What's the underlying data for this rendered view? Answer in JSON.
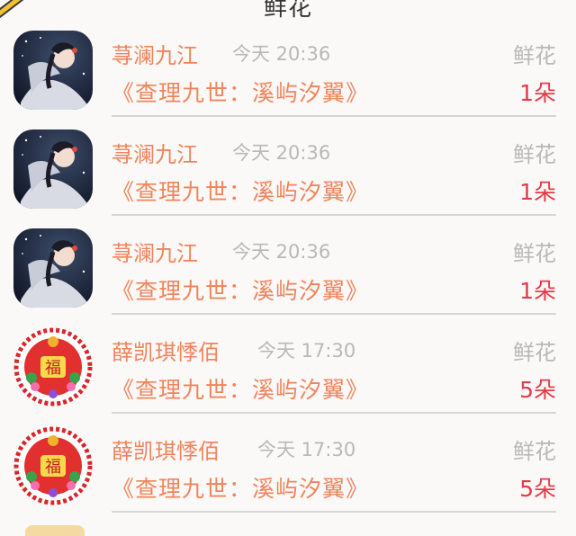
{
  "header": {
    "title": "鲜花"
  },
  "rows": [
    {
      "name": "荨澜九江",
      "time": "今天 20:36",
      "book": "《查理九世：溪屿汐翼》",
      "gift": "鲜花",
      "count": "1朵",
      "avatar": "anime-girl-avatar"
    },
    {
      "name": "荨澜九江",
      "time": "今天 20:36",
      "book": "《查理九世：溪屿汐翼》",
      "gift": "鲜花",
      "count": "1朵",
      "avatar": "anime-girl-avatar"
    },
    {
      "name": "荨澜九江",
      "time": "今天 20:36",
      "book": "《查理九世：溪屿汐翼》",
      "gift": "鲜花",
      "count": "1朵",
      "avatar": "anime-girl-avatar"
    },
    {
      "name": "薛凯琪悸佰",
      "time": "今天 17:30",
      "book": "《查理九世：溪屿汐翼》",
      "gift": "鲜花",
      "count": "5朵",
      "avatar": "fu-papercut-avatar"
    },
    {
      "name": "薛凯琪悸佰",
      "time": "今天 17:30",
      "book": "《查理九世：溪屿汐翼》",
      "gift": "鲜花",
      "count": "5朵",
      "avatar": "fu-papercut-avatar"
    }
  ],
  "colors": {
    "name": "#f0845a",
    "count": "#e33b4a",
    "muted": "#b8b8b8",
    "background": "#fbf8f8"
  }
}
